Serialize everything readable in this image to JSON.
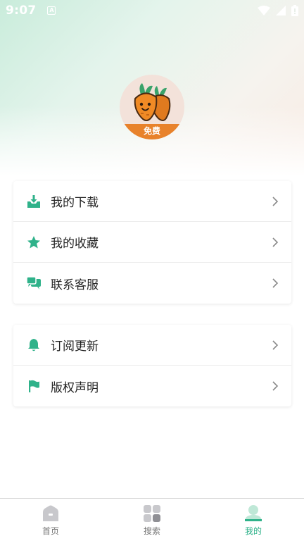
{
  "status_bar": {
    "time": "9:07",
    "notification_glyph": "A"
  },
  "profile": {
    "badge_text": "免费"
  },
  "menu_group_1": [
    {
      "label": "我的下载",
      "icon": "download-icon"
    },
    {
      "label": "我的收藏",
      "icon": "star-icon"
    },
    {
      "label": "联系客服",
      "icon": "chat-icon"
    }
  ],
  "menu_group_2": [
    {
      "label": "订阅更新",
      "icon": "bell-icon"
    },
    {
      "label": "版权声明",
      "icon": "flag-icon"
    }
  ],
  "tabs": [
    {
      "label": "首页",
      "icon": "home-icon",
      "active": false
    },
    {
      "label": "搜索",
      "icon": "grid-icon",
      "active": false
    },
    {
      "label": "我的",
      "icon": "person-icon",
      "active": true
    }
  ],
  "colors": {
    "accent": "#2fb28a",
    "badge": "#e8822b",
    "inactive": "#c8c8cc"
  }
}
